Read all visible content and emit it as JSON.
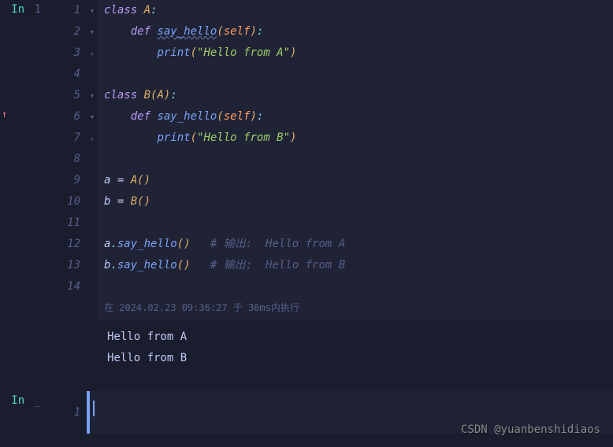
{
  "prompts": {
    "in_label": "In",
    "cell1_num": "1",
    "cell2_num": "_",
    "cell2_line": "1"
  },
  "lines": [
    {
      "n": "1",
      "fold": "▾"
    },
    {
      "n": "2",
      "fold": "▾"
    },
    {
      "n": "3",
      "fold": "▵"
    },
    {
      "n": "4",
      "fold": ""
    },
    {
      "n": "5",
      "fold": "▾"
    },
    {
      "n": "6",
      "fold": "▾"
    },
    {
      "n": "7",
      "fold": "▵"
    },
    {
      "n": "8",
      "fold": ""
    },
    {
      "n": "9",
      "fold": ""
    },
    {
      "n": "10",
      "fold": ""
    },
    {
      "n": "11",
      "fold": ""
    },
    {
      "n": "12",
      "fold": ""
    },
    {
      "n": "13",
      "fold": ""
    },
    {
      "n": "14",
      "fold": ""
    }
  ],
  "code": {
    "kw_class": "class",
    "kw_def": "def",
    "cls_A": "A",
    "cls_B": "B",
    "fn_say_hello": "say_hello",
    "fn_print": "print",
    "self": "self",
    "str_A": "\"Hello from A\"",
    "str_B": "\"Hello from B\"",
    "var_a": "a",
    "var_b": "b",
    "eq": " = ",
    "dot": ".",
    "lp": "(",
    "rp": ")",
    "colon": ":",
    "c1": "# 输出:  Hello from A",
    "c2": "# 输出:  Hello from B"
  },
  "status": "在 2024.02.23 09:36:27 于 36ms内执行",
  "output": {
    "l1": "Hello from A",
    "l2": "Hello from B"
  },
  "watermark": "CSDN @yuanbenshidiaos"
}
